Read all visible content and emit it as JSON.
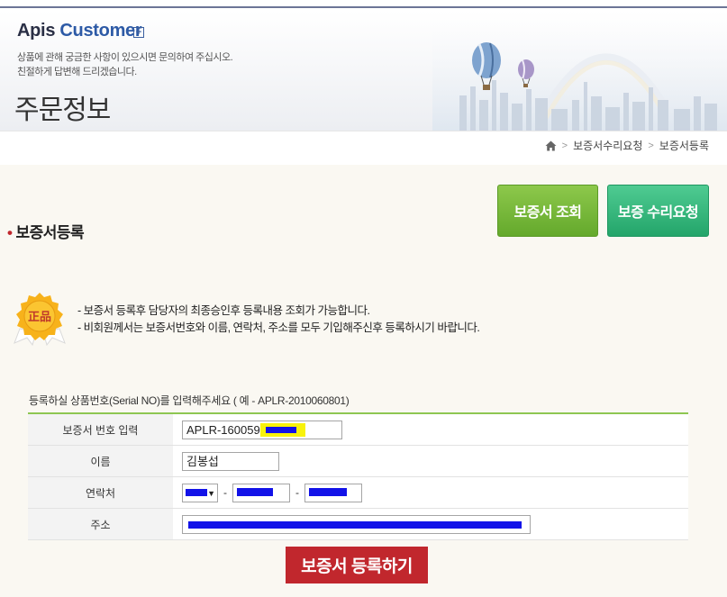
{
  "header": {
    "brand_primary": "Apis",
    "brand_secondary": "Customer",
    "brand_plus": "+",
    "desc_line1": "상품에 관해 궁금한 사항이 있으시면 문의하여 주십시오.",
    "desc_line2": "친절하게 답변해 드리겠습니다.",
    "page_title": "주문정보"
  },
  "breadcrumb": {
    "items": [
      "보증서수리요청",
      "보증서등록"
    ],
    "separator": ">"
  },
  "actions": {
    "inquiry_label": "보증서 조회",
    "repair_label": "보증 수리요청"
  },
  "section": {
    "title": "보증서등록",
    "bullet": "•"
  },
  "badge": {
    "text": "正品",
    "icon": "genuine-seal-icon"
  },
  "notice": {
    "line1": "- 보증서 등록후 담당자의 최종승인후 등록내용 조회가 가능합니다.",
    "line2": "- 비회원께서는 보증서번호와 이름, 연락처, 주소를 모두 기입해주신후 등록하시기 바랍니다."
  },
  "form": {
    "caption": "등록하실 상품번호(Serial NO)를 입력해주세요 ( 예 - APLR-2010060801)",
    "fields": {
      "serial": {
        "label": "보증서 번호 입력",
        "value": "APLR-1600595"
      },
      "name": {
        "label": "이름",
        "value": "김봉섭"
      },
      "phone": {
        "label": "연락처",
        "dash": "-"
      },
      "address": {
        "label": "주소"
      }
    },
    "submit_label": "보증서 등록하기"
  },
  "colors": {
    "accent_green": "#8ec652",
    "inquiry_button": "#6fb134",
    "repair_button": "#2ab575",
    "submit_button": "#c1272d",
    "redaction": "#1212e8",
    "highlight": "#f8f20a"
  }
}
